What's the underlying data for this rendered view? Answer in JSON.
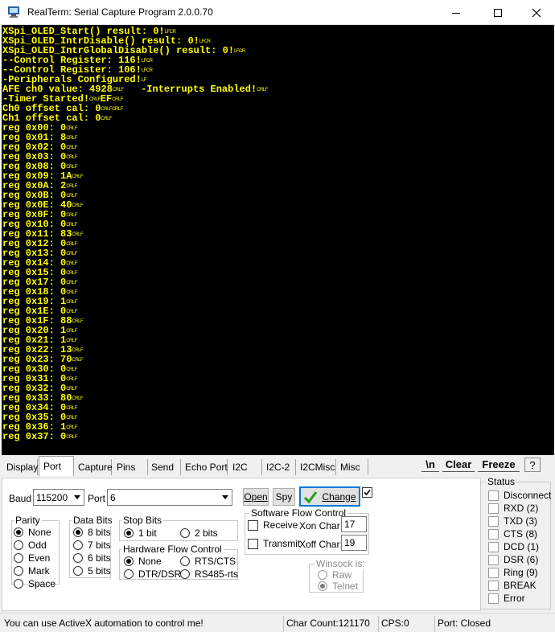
{
  "window": {
    "title": "RealTerm: Serial Capture Program 2.0.0.70"
  },
  "terminal": {
    "lines": [
      [
        {
          "t": "XSpi_OLED_Start() result: 0!"
        },
        {
          "c": "LFCR"
        }
      ],
      [
        {
          "t": "XSpi_OLED_IntrDisable() result: 0!"
        },
        {
          "c": "LFCR"
        }
      ],
      [
        {
          "t": "XSpi_OLED_IntrGlobalDisable() result: 0!"
        },
        {
          "c": "LFCR"
        }
      ],
      [
        {
          "t": "--Control Register: 116!"
        },
        {
          "c": "LFCR"
        }
      ],
      [
        {
          "t": "--Control Register: 106!"
        },
        {
          "c": "LFCR"
        }
      ],
      [
        {
          "t": "-Peripherals Configured!"
        },
        {
          "c": "LF"
        }
      ],
      [
        {
          "t": "AFE ch0 value: 4928"
        },
        {
          "c": "CRLF"
        },
        {
          "t": "   -Interrupts Enabled!"
        },
        {
          "c": "CRLF"
        }
      ],
      [
        {
          "t": "-Timer Started!"
        },
        {
          "c": "CRLF"
        },
        {
          "t": "EF"
        },
        {
          "c": "CRLF"
        }
      ],
      [
        {
          "t": "Ch0 offset cal: 0"
        },
        {
          "c": "CRLFCRLF"
        }
      ],
      [
        {
          "t": "Ch1 offset cal: 0"
        },
        {
          "c": "CRLF"
        }
      ],
      [
        {
          "t": "reg 0x00: 0"
        },
        {
          "c": "CRLF"
        }
      ],
      [
        {
          "t": "reg 0x01: 8"
        },
        {
          "c": "CRLF"
        }
      ],
      [
        {
          "t": "reg 0x02: 0"
        },
        {
          "c": "CRLF"
        }
      ],
      [
        {
          "t": "reg 0x03: 0"
        },
        {
          "c": "CRLF"
        }
      ],
      [
        {
          "t": "reg 0x08: 0"
        },
        {
          "c": "CRLF"
        }
      ],
      [
        {
          "t": "reg 0x09: 1A"
        },
        {
          "c": "CRLF"
        }
      ],
      [
        {
          "t": "reg 0x0A: 2"
        },
        {
          "c": "CRLF"
        }
      ],
      [
        {
          "t": "reg 0x0B: 0"
        },
        {
          "c": "CRLF"
        }
      ],
      [
        {
          "t": "reg 0x0E: 40"
        },
        {
          "c": "CRLF"
        }
      ],
      [
        {
          "t": "reg 0x0F: 0"
        },
        {
          "c": "CRLF"
        }
      ],
      [
        {
          "t": "reg 0x10: 0"
        },
        {
          "c": "CRLF"
        }
      ],
      [
        {
          "t": "reg 0x11: 83"
        },
        {
          "c": "CRLF"
        }
      ],
      [
        {
          "t": "reg 0x12: 0"
        },
        {
          "c": "CRLF"
        }
      ],
      [
        {
          "t": "reg 0x13: 0"
        },
        {
          "c": "CRLF"
        }
      ],
      [
        {
          "t": "reg 0x14: 0"
        },
        {
          "c": "CRLF"
        }
      ],
      [
        {
          "t": "reg 0x15: 0"
        },
        {
          "c": "CRLF"
        }
      ],
      [
        {
          "t": "reg 0x17: 0"
        },
        {
          "c": "CRLF"
        }
      ],
      [
        {
          "t": "reg 0x18: 0"
        },
        {
          "c": "CRLF"
        }
      ],
      [
        {
          "t": "reg 0x19: 1"
        },
        {
          "c": "CRLF"
        }
      ],
      [
        {
          "t": "reg 0x1E: 0"
        },
        {
          "c": "CRLF"
        }
      ],
      [
        {
          "t": "reg 0x1F: 88"
        },
        {
          "c": "CRLF"
        }
      ],
      [
        {
          "t": "reg 0x20: 1"
        },
        {
          "c": "CRLF"
        }
      ],
      [
        {
          "t": "reg 0x21: 1"
        },
        {
          "c": "CRLF"
        }
      ],
      [
        {
          "t": "reg 0x22: 13"
        },
        {
          "c": "CRLF"
        }
      ],
      [
        {
          "t": "reg 0x23: 70"
        },
        {
          "c": "CRLF"
        }
      ],
      [
        {
          "t": "reg 0x30: 0"
        },
        {
          "c": "CRLF"
        }
      ],
      [
        {
          "t": "reg 0x31: 0"
        },
        {
          "c": "CRLF"
        }
      ],
      [
        {
          "t": "reg 0x32: 0"
        },
        {
          "c": "CRLF"
        }
      ],
      [
        {
          "t": "reg 0x33: 80"
        },
        {
          "c": "CRLF"
        }
      ],
      [
        {
          "t": "reg 0x34: 0"
        },
        {
          "c": "CRLF"
        }
      ],
      [
        {
          "t": "reg 0x35: 0"
        },
        {
          "c": "CRLF"
        }
      ],
      [
        {
          "t": "reg 0x36: 1"
        },
        {
          "c": "CRLF"
        }
      ],
      [
        {
          "t": "reg 0x37: 0"
        },
        {
          "c": "CRLF"
        }
      ]
    ],
    "background": "#000000",
    "text_color": "#ffff00"
  },
  "tabs": [
    "Display",
    "Port",
    "Capture",
    "Pins",
    "Send",
    "Echo Port",
    "I2C",
    "I2C-2",
    "I2CMisc",
    "Misc"
  ],
  "active_tab": "Port",
  "toolbar": {
    "newline_label": "\\n",
    "clear_label": "Clear",
    "freeze_label": "Freeze",
    "help_label": "?"
  },
  "port": {
    "baud_label": "Baud",
    "baud_value": "115200",
    "port_label": "Port",
    "port_value": "6",
    "open_label": "Open",
    "spy_label": "Spy",
    "change_label": "Change",
    "change_checked": true,
    "parity": {
      "title": "Parity",
      "options": [
        "None",
        "Odd",
        "Even",
        "Mark",
        "Space"
      ],
      "selected": "None"
    },
    "data_bits": {
      "title": "Data Bits",
      "options": [
        "8 bits",
        "7 bits",
        "6 bits",
        "5 bits"
      ],
      "selected": "8 bits"
    },
    "stop_bits": {
      "title": "Stop Bits",
      "options": [
        "1 bit",
        "2 bits"
      ],
      "selected": "1 bit"
    },
    "hw_flow": {
      "title": "Hardware Flow Control",
      "options": [
        "None",
        "RTS/CTS",
        "DTR/DSR",
        "RS485-rts"
      ],
      "selected": "None"
    },
    "sw_flow": {
      "title": "Software Flow Control",
      "receive_label": "Receive",
      "transmit_label": "Transmit",
      "xon_label": "Xon Char:",
      "xon_value": "17",
      "xoff_label": "Xoff Char:",
      "xoff_value": "19"
    },
    "winsock": {
      "title": "Winsock is:",
      "options": [
        "Raw",
        "Telnet"
      ],
      "selected": "Telnet"
    }
  },
  "status_panel": {
    "title": "Status",
    "items": [
      "Disconnect",
      "RXD (2)",
      "TXD (3)",
      "CTS (8)",
      "DCD (1)",
      "DSR (6)",
      "Ring (9)",
      "BREAK",
      "Error"
    ]
  },
  "statusbar": {
    "message": "You can use ActiveX automation to control me!",
    "char_count": "Char Count:121170",
    "cps": "CPS:0",
    "port_status": "Port: Closed"
  }
}
